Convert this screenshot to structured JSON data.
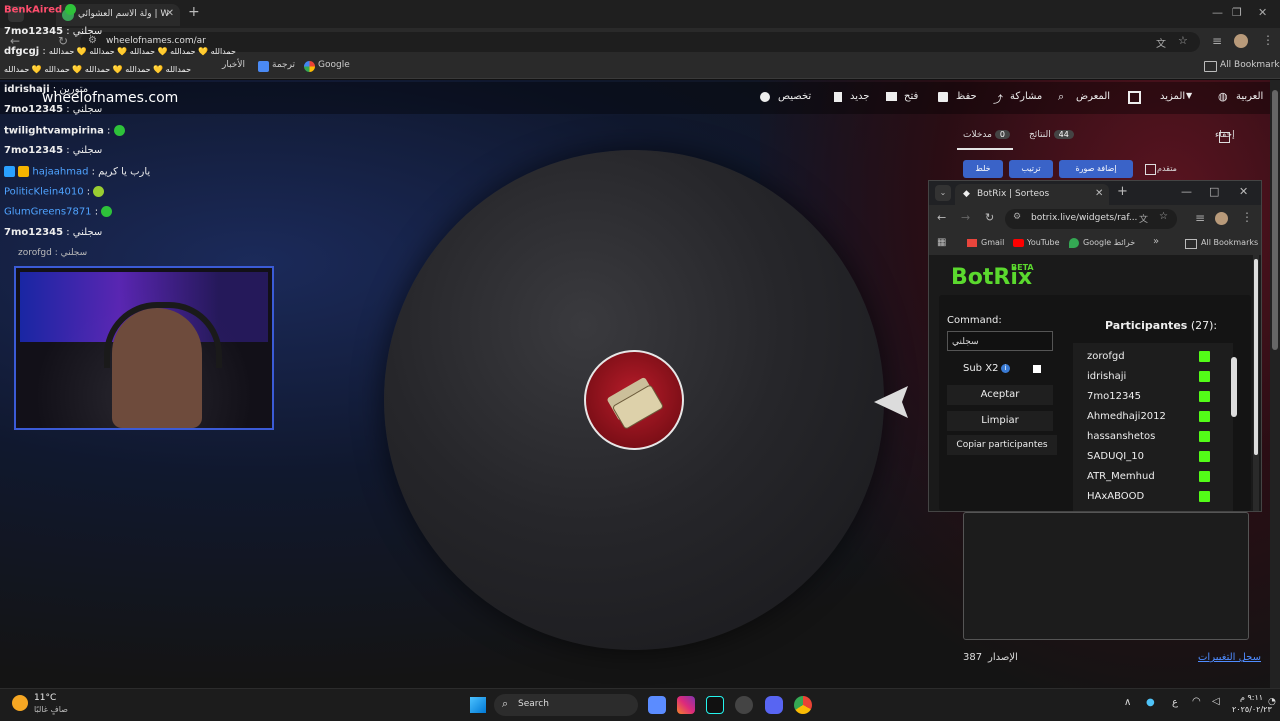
{
  "browser": {
    "tab_title": "ولة الاسم العشوائي | Wheel of Names",
    "url": "wheelofnames.com/ar",
    "bookmarks": [
      "الأخبار",
      "ترجمة",
      "Google"
    ],
    "all_bookmarks": "All Bookmarks"
  },
  "site": {
    "logo": "wheelofnames.com",
    "nav": [
      "تخصيص",
      "جديد",
      "فتح",
      "حفظ",
      "مشاركة",
      "المعرض",
      "المزيد",
      "العربية"
    ],
    "tabs": {
      "entries_label": "مدخلات",
      "entries_count": "0",
      "results_label": "النتائج",
      "results_count": "44"
    },
    "hide_label": "إخفاء",
    "shuffle": "خلط",
    "sort": "ترتيب",
    "add_image": "إضافة صورة",
    "advanced": "متقدم",
    "version_label": "الإصدار",
    "version": "387",
    "changelog": "سجل التغييرات"
  },
  "chat": [
    {
      "user": "BenkAired",
      "text": "",
      "color": "#ff4d6d"
    },
    {
      "user": "7mo12345",
      "text": "سجلني",
      "color": "#ffffff"
    },
    {
      "user": "dfgcgj",
      "text": "حمدالله 💛 حمدالله 💛 حمدالله 💛 حمدالله 💛 حمدالله",
      "color": "#ffffff"
    },
    {
      "user": "",
      "text": "حمدالله 💛 حمدالله 💛 حمدالله 💛 حمدالله 💛 حمدالله",
      "color": "#ffffff"
    },
    {
      "user": "idrishaji",
      "text": "متورين",
      "color": "#ffffff"
    },
    {
      "user": "7mo12345",
      "text": "سجلني",
      "color": "#ffffff"
    },
    {
      "user": "twilightvampirina",
      "text": "",
      "color": "#ffffff"
    },
    {
      "user": "7mo12345",
      "text": "سجلني",
      "color": "#ffffff"
    },
    {
      "user": "hajaahmad",
      "text": "يارب يا كريم",
      "color": "#4fa3ff"
    },
    {
      "user": "PoliticKlein4010",
      "text": "",
      "color": "#4fa3ff"
    },
    {
      "user": "GlumGreens7871",
      "text": "",
      "color": "#4fa3ff"
    },
    {
      "user": "7mo12345",
      "text": "سجلني",
      "color": "#ffffff"
    },
    {
      "user": "zorofgd",
      "text": "سجلني",
      "color": "#bbbbbb"
    }
  ],
  "botrix": {
    "tab_title": "BotRix | Sorteos",
    "url": "botrix.live/widgets/raf...",
    "bookmarks": [
      "Gmail",
      "YouTube",
      "Google خرائط"
    ],
    "all_bookmarks": "All Bookmarks",
    "brand": "BotRix",
    "brand_tag": "BETA",
    "command_label": "Command:",
    "command_value": "سجلني",
    "sub_x2": "Sub X2",
    "accept": "Aceptar",
    "clear": "Limpiar",
    "copy": "Copiar participantes",
    "participants_label": "Participantes",
    "participants_count": "(27):",
    "participants": [
      "zorofgd",
      "idrishaji",
      "7mo12345",
      "Ahmedhaji2012",
      "hassanshetos",
      "SADUQI_10",
      "ATR_Memhud",
      "HAxABOOD"
    ]
  },
  "taskbar": {
    "weather_temp": "11°C",
    "weather_desc": "صافٍ غالبًا",
    "search": "Search",
    "clock_time": "٩:١١ م",
    "clock_date": "٢٠٢٥/٠٢/٢٣",
    "lang": "ع"
  }
}
